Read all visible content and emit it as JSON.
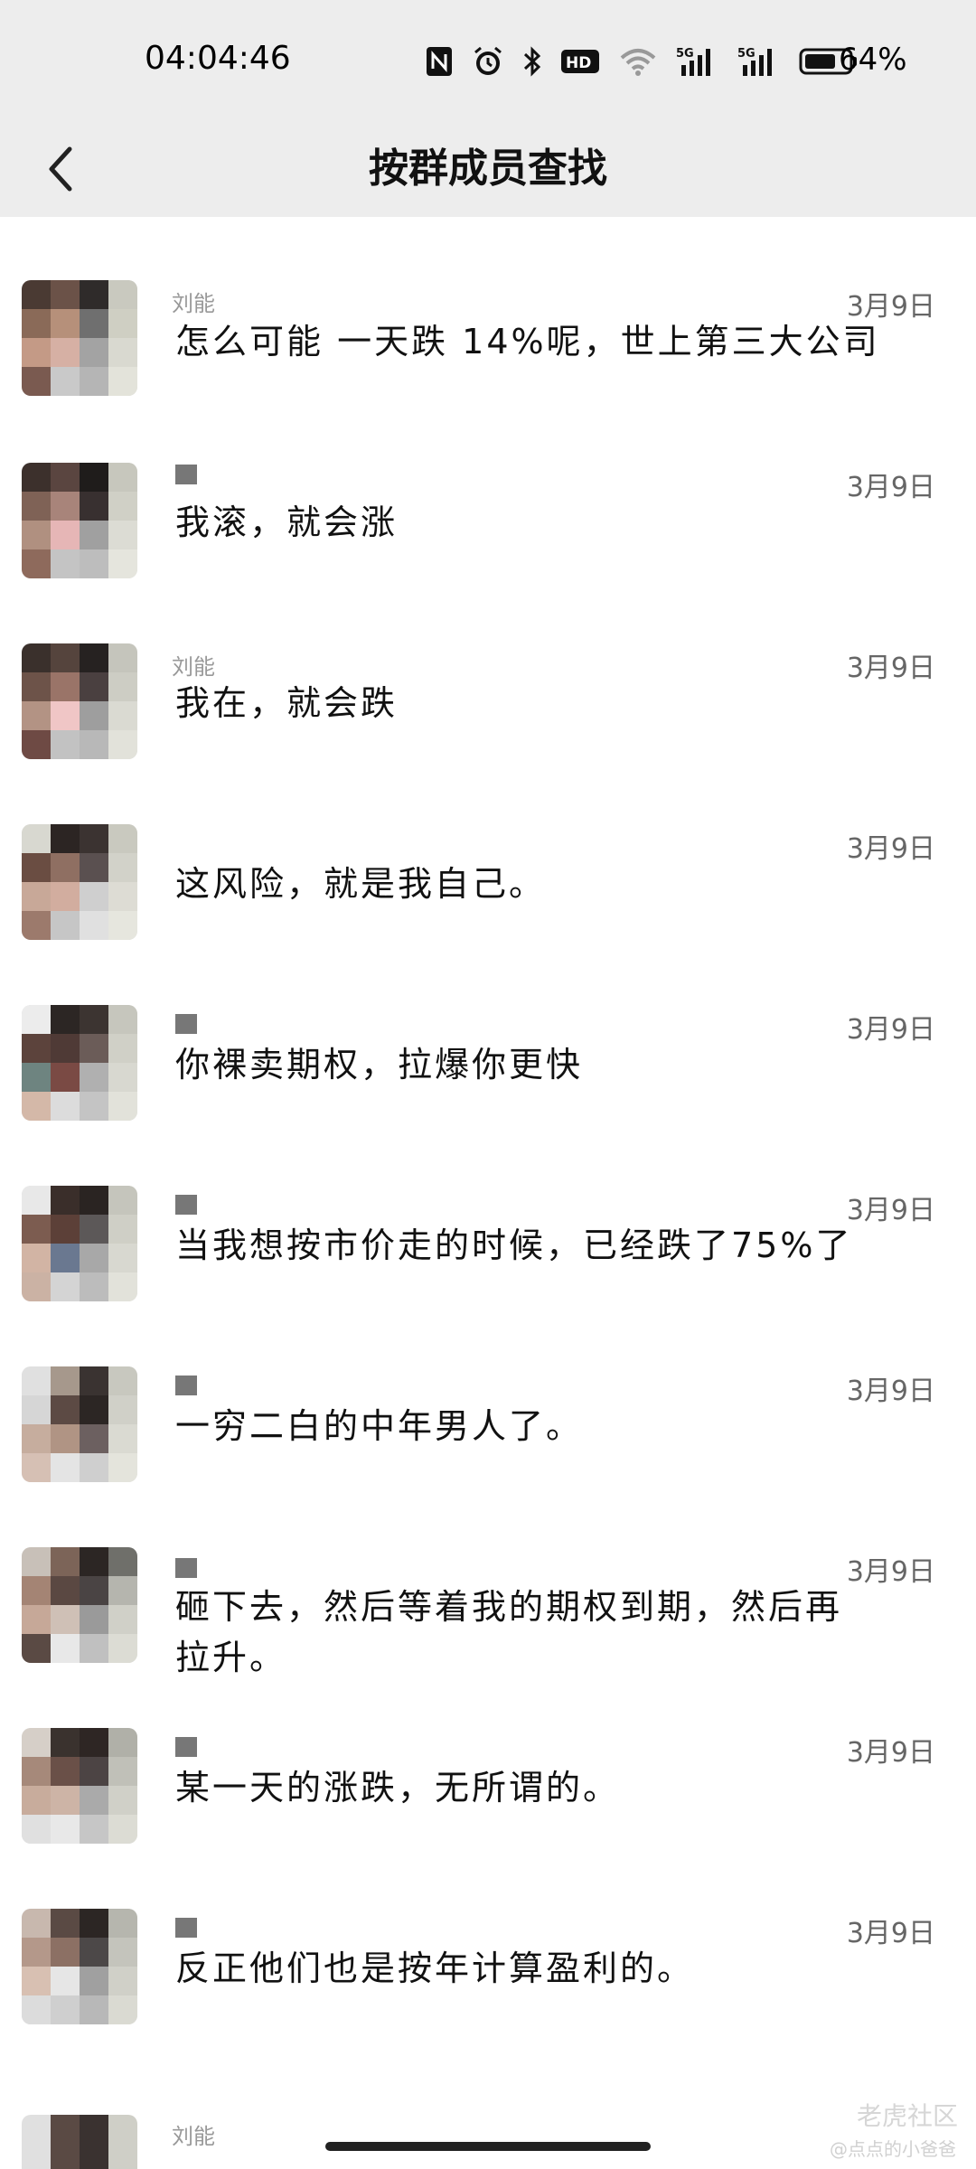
{
  "status_bar": {
    "time": "04:04:46",
    "battery": "64%",
    "icons": [
      "nfc-icon",
      "alarm-icon",
      "bluetooth-icon",
      "hd-icon",
      "wifi-icon",
      "signal-5g-icon",
      "signal-5g-icon",
      "battery-icon"
    ]
  },
  "header": {
    "title": "按群成员查找",
    "back_icon": "chevron-left-icon"
  },
  "messages": [
    {
      "name": "刘能",
      "text": "怎么可能 一天跌 14%呢，世上第三大公司",
      "date": "3月9日"
    },
    {
      "name": "",
      "text": "我滚，就会涨",
      "date": "3月9日"
    },
    {
      "name": "刘能",
      "text": "我在，就会跌",
      "date": "3月9日"
    },
    {
      "name": "",
      "text": "这风险，就是我自己。",
      "date": "3月9日"
    },
    {
      "name": "",
      "text": "你裸卖期权，拉爆你更快",
      "date": "3月9日"
    },
    {
      "name": "",
      "text": "当我想按市价走的时候，已经跌了75%了",
      "date": "3月9日"
    },
    {
      "name": "",
      "text": "一穷二白的中年男人了。",
      "date": "3月9日"
    },
    {
      "name": "",
      "text": "砸下去，然后等着我的期权到期，然后再拉升。",
      "date": "3月9日"
    },
    {
      "name": "",
      "text": "某一天的涨跌，无所谓的。",
      "date": "3月9日"
    },
    {
      "name": "",
      "text": "反正他们也是按年计算盈利的。",
      "date": "3月9日"
    }
  ],
  "partial_row_name": "刘能",
  "watermark": {
    "main": "老虎社区",
    "sub": "@点点的小爸爸"
  },
  "colors": {
    "header_bg": "#ededed",
    "list_bg": "#ffffff",
    "text": "#111111",
    "date": "#666666"
  }
}
